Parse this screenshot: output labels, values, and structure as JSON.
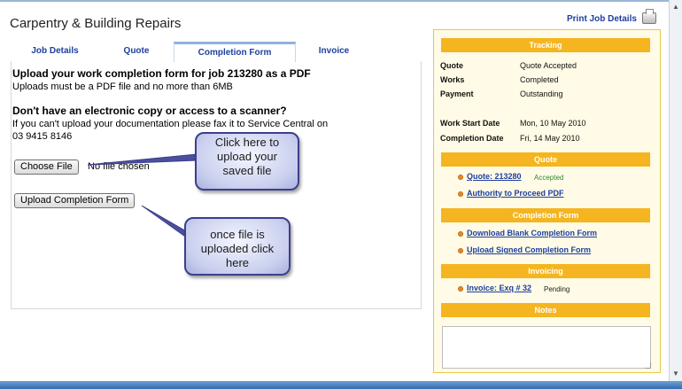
{
  "header": {
    "title": "Carpentry & Building Repairs",
    "print_label": "Print Job Details"
  },
  "tabs": [
    {
      "label": "Job Details"
    },
    {
      "label": "Quote"
    },
    {
      "label": "Completion Form",
      "active": true
    },
    {
      "label": "Invoice"
    }
  ],
  "main": {
    "heading": "Upload your work completion form for job 213280 as a PDF",
    "subtext": "Uploads must be a PDF file and no more than 6MB",
    "heading2": "Don't have an electronic copy or access to a scanner?",
    "fax_line1": "If you can't upload your documentation please fax it to Service Central on",
    "fax_line2": "03 9415 8146",
    "choose_file_label": "Choose File",
    "no_file_text": "No file chosen",
    "upload_label": "Upload Completion Form"
  },
  "callouts": {
    "c1": [
      "Click here to",
      "upload your",
      "saved file"
    ],
    "c2": [
      "once file is",
      "uploaded click",
      "here"
    ]
  },
  "sidebar": {
    "tracking": {
      "title": "Tracking",
      "rows": [
        {
          "label": "Quote",
          "value": "Quote Accepted"
        },
        {
          "label": "Works",
          "value": "Completed"
        },
        {
          "label": "Payment",
          "value": "Outstanding"
        }
      ],
      "dates": [
        {
          "label": "Work Start Date",
          "value": "Mon, 10 May 2010"
        },
        {
          "label": "Completion Date",
          "value": "Fri, 14 May 2010"
        }
      ]
    },
    "quote": {
      "title": "Quote",
      "quote_link": "Quote: 213280",
      "quote_status": "Accepted",
      "atp_link": "Authority to Proceed PDF"
    },
    "completion": {
      "title": "Completion Form",
      "download_link": "Download Blank Completion Form",
      "upload_link": "Upload Signed Completion Form"
    },
    "invoicing": {
      "title": "Invoicing",
      "invoice_link": "Invoice: Exq # 32",
      "invoice_status": "Pending"
    },
    "notes": {
      "title": "Notes"
    }
  },
  "colors": {
    "section_header": "#f5b520",
    "link": "#1d3f9e",
    "accepted": "#2e8b2e",
    "callout_border": "#3c3f8c"
  }
}
